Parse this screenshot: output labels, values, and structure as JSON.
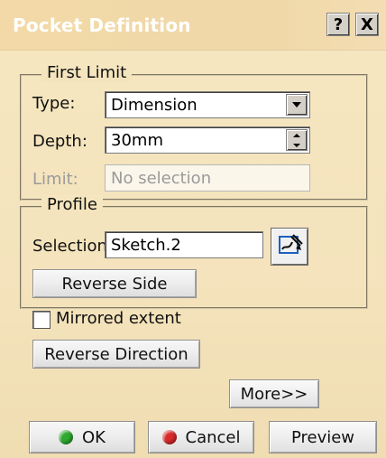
{
  "window": {
    "title": "Pocket Definition",
    "help_label": "?",
    "close_label": "X"
  },
  "first_limit": {
    "label": "First Limit",
    "type_label": "Type:",
    "type_value": "Dimension",
    "depth_label": "Depth:",
    "depth_value": "30mm",
    "limit_label": "Limit:",
    "limit_value": "No selection"
  },
  "profile": {
    "label": "Profile",
    "selection_label": "Selection:",
    "selection_value": "Sketch.2",
    "reverse_side_label": "Reverse Side"
  },
  "options": {
    "mirrored_extent_label": "Mirrored extent",
    "mirrored_extent_checked": false,
    "reverse_direction_label": "Reverse Direction",
    "more_label": "More>>"
  },
  "footer": {
    "ok_label": "OK",
    "cancel_label": "Cancel",
    "preview_label": "Preview"
  },
  "icons": {
    "ok": "green-dot-icon",
    "cancel": "red-dot-icon",
    "sketcher": "sketcher-icon",
    "combo": "chevron-down-icon",
    "spinner": "spinner-updown-icon"
  },
  "colors": {
    "dialog_bg": "#f4e3bc",
    "ok_led": "#2fa92f",
    "cancel_led": "#d82a2a"
  }
}
